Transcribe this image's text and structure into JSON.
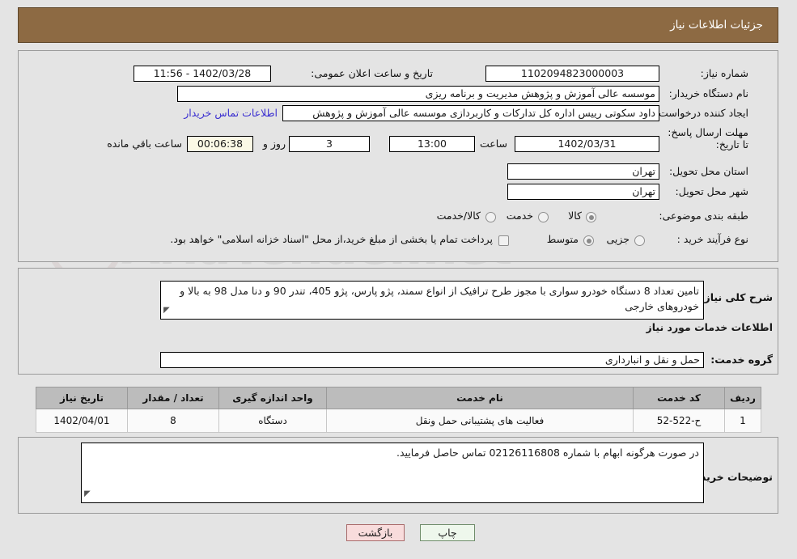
{
  "header": {
    "title": "جزئیات اطلاعات نیاز"
  },
  "form": {
    "need_number": {
      "label": "شماره نیاز:",
      "value": "1102094823000003"
    },
    "announce_datetime": {
      "label": "تاریخ و ساعت اعلان عمومی:",
      "value": "1402/03/28 - 11:56"
    },
    "buyer_org": {
      "label": "نام دستگاه خریدار:",
      "value": "موسسه عالی آموزش و پژوهش مدیریت و برنامه ریزی"
    },
    "requester": {
      "label": "ایجاد کننده درخواست:",
      "value": "داود سکوتی رییس اداره کل تدارکات و کاربردازی موسسه عالی آموزش و پژوهش",
      "contact_link": "اطلاعات تماس خریدار"
    },
    "deadline": {
      "label": "مهلت ارسال پاسخ: تا تاریخ:",
      "date": "1402/03/31",
      "time_label": "ساعت",
      "time": "13:00",
      "days": "3",
      "days_suffix": "روز و",
      "countdown": "00:06:38",
      "countdown_suffix": "ساعت باقي مانده"
    },
    "delivery_province": {
      "label": "استان محل تحویل:",
      "value": "تهران"
    },
    "delivery_city": {
      "label": "شهر محل تحویل:",
      "value": "تهران"
    },
    "subject_class": {
      "label": "طبقه بندی موضوعی:",
      "options": [
        {
          "label": "کالا",
          "selected": true
        },
        {
          "label": "خدمت",
          "selected": false
        },
        {
          "label": "کالا/خدمت",
          "selected": false
        }
      ]
    },
    "purchase_type": {
      "label": "نوع فرآیند خرید :",
      "options": [
        {
          "label": "جزیی",
          "selected": false
        },
        {
          "label": "متوسط",
          "selected": true
        }
      ],
      "checkbox_label": "پرداخت تمام یا بخشی از مبلغ خرید،از محل \"اسناد خزانه اسلامی\" خواهد بود.",
      "checkbox_checked": false
    }
  },
  "description": {
    "label": "شرح کلی نیاز:",
    "value": "تامین تعداد 8 دستگاه خودرو سواری با مجوز طرح ترافیک از انواع سمند، پژو پارس، پژو 405، تندر 90 و دنا مدل 98 به بالا و خودروهای خارجی"
  },
  "services_section": {
    "title": "اطلاعات خدمات مورد نیاز",
    "group_label": "گروه خدمت:",
    "group_value": "حمل و نقل و انبارداری"
  },
  "table": {
    "columns": [
      "ردیف",
      "کد خدمت",
      "نام خدمت",
      "واحد اندازه گیری",
      "تعداد / مقدار",
      "تاریخ نیاز"
    ],
    "rows": [
      {
        "row": "1",
        "service_code": "ح-522-52",
        "service_name": "فعالیت های پشتیبانی حمل ونقل",
        "unit": "دستگاه",
        "quantity": "8",
        "need_date": "1402/04/01"
      }
    ]
  },
  "buyer_notes": {
    "label": "توضیحات خریدار:",
    "value": "در صورت هرگونه ابهام با شماره 02126116808 تماس حاصل فرمایید."
  },
  "buttons": {
    "print": "چاپ",
    "back": "بازگشت"
  },
  "watermark": {
    "text": "AriaTender.net"
  },
  "colors": {
    "header_bg": "#8d6a43",
    "page_bg": "#e4e4e4",
    "link": "#3b2fd0",
    "print_btn_bg": "#eef7ec",
    "back_btn_bg": "#f8dcdc",
    "table_header_bg": "#bcbcbc",
    "timer_bg": "#fbf9e6"
  }
}
